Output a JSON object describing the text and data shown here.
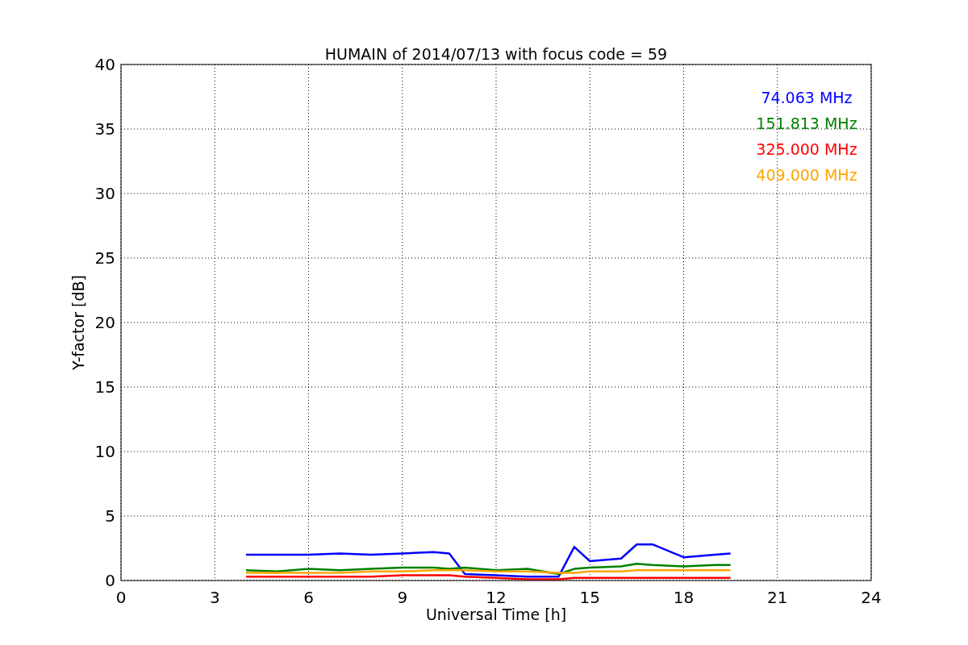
{
  "chart_data": {
    "type": "line",
    "title": "HUMAIN of 2014/07/13 with focus code = 59",
    "xlabel": "Universal Time [h]",
    "ylabel": "Y-factor [dB]",
    "x": [
      4,
      5,
      6,
      7,
      8,
      9,
      10,
      10.5,
      11,
      12,
      13,
      14,
      14.5,
      15,
      16,
      16.5,
      17,
      18,
      19,
      19.5
    ],
    "series": [
      {
        "name": "74.063 MHz",
        "color": "#0000ff",
        "values": [
          2,
          2,
          2,
          2.1,
          2,
          2.1,
          2.2,
          2.1,
          0.5,
          0.4,
          0.3,
          0.3,
          2.6,
          1.5,
          1.7,
          2.8,
          2.8,
          1.8,
          2,
          2.1
        ]
      },
      {
        "name": "151.813 MHz",
        "color": "#008000",
        "values": [
          0.8,
          0.7,
          0.9,
          0.8,
          0.9,
          1,
          1,
          0.9,
          1,
          0.8,
          0.9,
          0.5,
          0.9,
          1,
          1.1,
          1.3,
          1.2,
          1.1,
          1.2,
          1.2
        ]
      },
      {
        "name": "325.000 MHz",
        "color": "#ff0000",
        "values": [
          0.3,
          0.3,
          0.3,
          0.3,
          0.3,
          0.4,
          0.4,
          0.4,
          0.3,
          0.2,
          0.1,
          0.1,
          0.2,
          0.2,
          0.2,
          0.2,
          0.2,
          0.2,
          0.2,
          0.2
        ]
      },
      {
        "name": "409.000 MHz",
        "color": "#ffa500",
        "values": [
          0.6,
          0.6,
          0.6,
          0.6,
          0.7,
          0.7,
          0.8,
          0.8,
          0.8,
          0.7,
          0.7,
          0.6,
          0.6,
          0.7,
          0.7,
          0.8,
          0.8,
          0.8,
          0.8,
          0.8
        ]
      }
    ],
    "xlim": [
      0,
      24
    ],
    "ylim": [
      0,
      40
    ],
    "xticks": [
      0,
      3,
      6,
      9,
      12,
      15,
      18,
      21,
      24
    ],
    "yticks": [
      0,
      5,
      10,
      15,
      20,
      25,
      30,
      35,
      40
    ],
    "grid": true
  }
}
